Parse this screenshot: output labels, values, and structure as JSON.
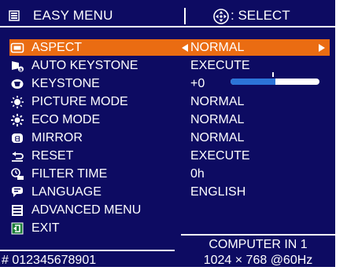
{
  "header": {
    "title": "EASY MENU",
    "select_label": ": SELECT"
  },
  "menu": {
    "items": [
      {
        "icon": "aspect-icon",
        "label": "ASPECT",
        "value": "NORMAL"
      },
      {
        "icon": "auto-keystone-icon",
        "label": "AUTO KEYSTONE",
        "value": "EXECUTE"
      },
      {
        "icon": "keystone-icon",
        "label": "KEYSTONE",
        "value": "+0"
      },
      {
        "icon": "picture-mode-icon",
        "label": "PICTURE MODE",
        "value": "NORMAL"
      },
      {
        "icon": "eco-mode-icon",
        "label": "ECO MODE",
        "value": "NORMAL"
      },
      {
        "icon": "mirror-icon",
        "label": "MIRROR",
        "value": "NORMAL"
      },
      {
        "icon": "reset-icon",
        "label": "RESET",
        "value": "EXECUTE"
      },
      {
        "icon": "filter-time-icon",
        "label": "FILTER TIME",
        "value": "0h"
      },
      {
        "icon": "language-icon",
        "label": "LANGUAGE",
        "value": "ENGLISH"
      },
      {
        "icon": "advanced-menu-icon",
        "label": "ADVANCED MENU",
        "value": ""
      },
      {
        "icon": "exit-icon",
        "label": "EXIT",
        "value": ""
      }
    ],
    "selected_index": 0
  },
  "keystone_slider": {
    "value": 0,
    "min": -40,
    "max": 40,
    "fill_fraction": 0.5
  },
  "footer": {
    "serial": "# 012345678901",
    "input_source": "COMPUTER IN 1",
    "signal": "1024 × 768 @60Hz"
  },
  "colors": {
    "background": "#0d0b62",
    "highlight": "#ea6c12",
    "slider_fill": "#2c74d8",
    "text": "#ffffff"
  }
}
